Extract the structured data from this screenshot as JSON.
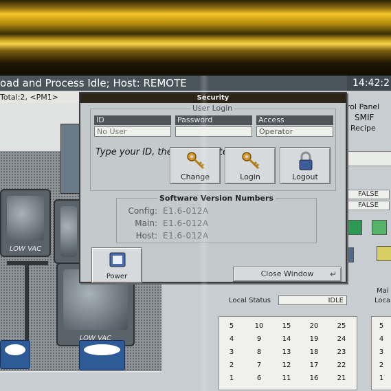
{
  "header": {
    "title": "oad and Process Idle; Host: REMOTE",
    "time": "14:42:2",
    "subtitle": "Total:2, <PM1>"
  },
  "tool_view": {
    "chamber_left_label": "LOW VAC",
    "chamber_bottom_label": "LOW VAC"
  },
  "side_panel": {
    "title": "rol Panel",
    "smif": "SMIF",
    "recipe": "Recipe",
    "flag1": "FALSE",
    "flag2": "FALSE",
    "local_status_label": "Local Status",
    "local_status_value": "IDLE",
    "main_label": "Mai",
    "local_status_label2": "Loca",
    "slots_left": [
      [
        "5",
        "10",
        "15",
        "20",
        "25"
      ],
      [
        "4",
        "9",
        "14",
        "19",
        "24"
      ],
      [
        "3",
        "8",
        "13",
        "18",
        "23"
      ],
      [
        "2",
        "7",
        "12",
        "17",
        "22"
      ],
      [
        "1",
        "6",
        "11",
        "16",
        "21"
      ]
    ],
    "slots_right": [
      "5",
      "4",
      "3",
      "2",
      "1"
    ]
  },
  "dialog": {
    "title": "Security",
    "login_group_label": "User Login",
    "col_id": "ID",
    "col_password": "Password",
    "col_access": "Access",
    "id_value": "No User",
    "password_value": "",
    "access_value": "Operator",
    "prompt": "Type your ID, then press Enter",
    "change_label": "Change",
    "login_label": "Login",
    "logout_label": "Logout",
    "version_group_label": "Software Version Numbers",
    "config_label": "Config:",
    "config_value": "E1.6-012A",
    "main_label": "Main:",
    "main_value": "E1.6-012A",
    "host_label": "Host:",
    "host_value": "E1.6-012A",
    "power_label": "Power",
    "close_label": "Close Window"
  },
  "colors": {
    "title_bar": "#4b565c",
    "dialog_bg": "#c4c9cb",
    "key_gold": "#d39a2a",
    "lock_blue": "#3c5c9a"
  },
  "icons": {
    "change": "key-icon",
    "login": "key-icon",
    "logout": "padlock-icon",
    "power": "power-icon",
    "close": "return-arrow-icon"
  }
}
